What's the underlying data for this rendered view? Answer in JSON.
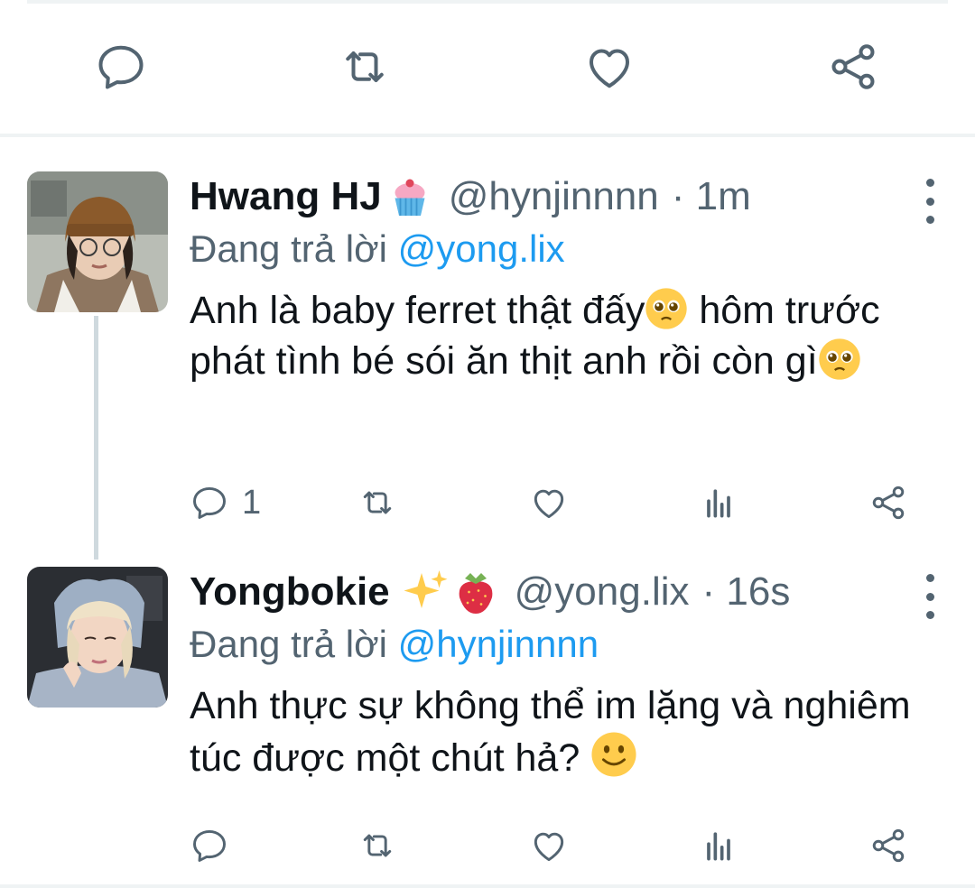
{
  "main_tweet_actions": [
    "reply-icon",
    "retweet-icon",
    "like-icon",
    "share-icon"
  ],
  "tweets": [
    {
      "name": "Hwang HJ",
      "name_emoji": "cupcake-emoji",
      "handle": "@hynjinnnn",
      "time": "· 1m",
      "replying_prefix": "Đang trả lời",
      "replying_to": "@yong.lix",
      "text_parts": [
        "Anh là baby ferret thật đấy",
        " hôm trước phát tình bé sói ăn thịt anh rồi còn gì"
      ],
      "text_emoji": "pleading-face-emoji",
      "reply_count": "1"
    },
    {
      "name": "Yongbokie",
      "name_emoji": "sparkles-strawberry-emoji",
      "handle": "@yong.lix",
      "time": "· 16s",
      "replying_prefix": "Đang trả lời",
      "replying_to": "@hynjinnnn",
      "text": "Anh thực sự không thể im lặng và nghiêm túc được một chút hả?",
      "text_emoji": "slightly-smiling-face-emoji",
      "reply_count": ""
    }
  ],
  "colors": {
    "text": "#0f1419",
    "secondary": "#536471",
    "link": "#1d9bf0",
    "divider": "#eff3f4",
    "thread_line": "#cfd9de"
  }
}
